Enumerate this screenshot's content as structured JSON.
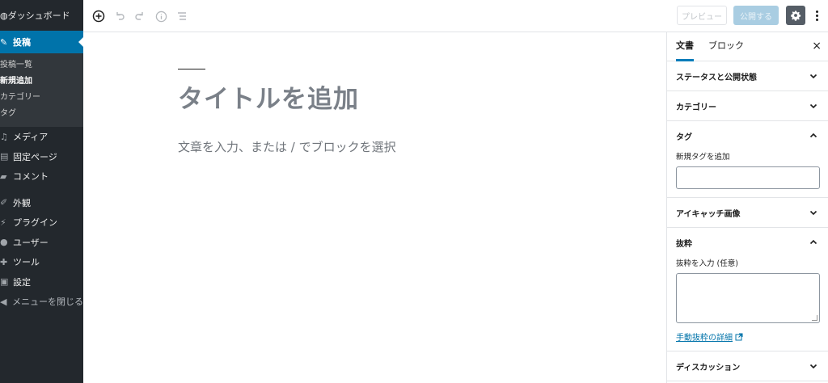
{
  "admin_menu": {
    "site_title": "ダッシュボード",
    "current": "投稿",
    "submenu": [
      "投稿一覧",
      "新規追加",
      "カテゴリー",
      "タグ"
    ],
    "items_a": [
      "メディア",
      "固定ページ",
      "コメント"
    ],
    "items_b": [
      "外観",
      "プラグイン",
      "ユーザー",
      "ツール",
      "設定"
    ],
    "collapse": "メニューを閉じる"
  },
  "toolbar": {
    "preview_label": "プレビュー",
    "publish_label": "公開する"
  },
  "editor": {
    "title_placeholder": "タイトルを追加",
    "body_placeholder": "文章を入力、または / でブロックを選択"
  },
  "sidebar": {
    "tabs": [
      "文書",
      "ブロック"
    ],
    "close": "×",
    "panels": {
      "status": "ステータスと公開状態",
      "categories": "カテゴリー",
      "tags": "タグ",
      "tags_label": "新規タグを追加",
      "featured": "アイキャッチ画像",
      "excerpt": "抜粋",
      "excerpt_label": "抜粋を入力 (任意)",
      "excerpt_link": "手動抜粋の詳細",
      "discussion": "ディスカッション"
    }
  },
  "colors": {
    "admin_bg": "#23282d",
    "accent": "#0073aa",
    "publish_disabled": "#a9cde2"
  }
}
